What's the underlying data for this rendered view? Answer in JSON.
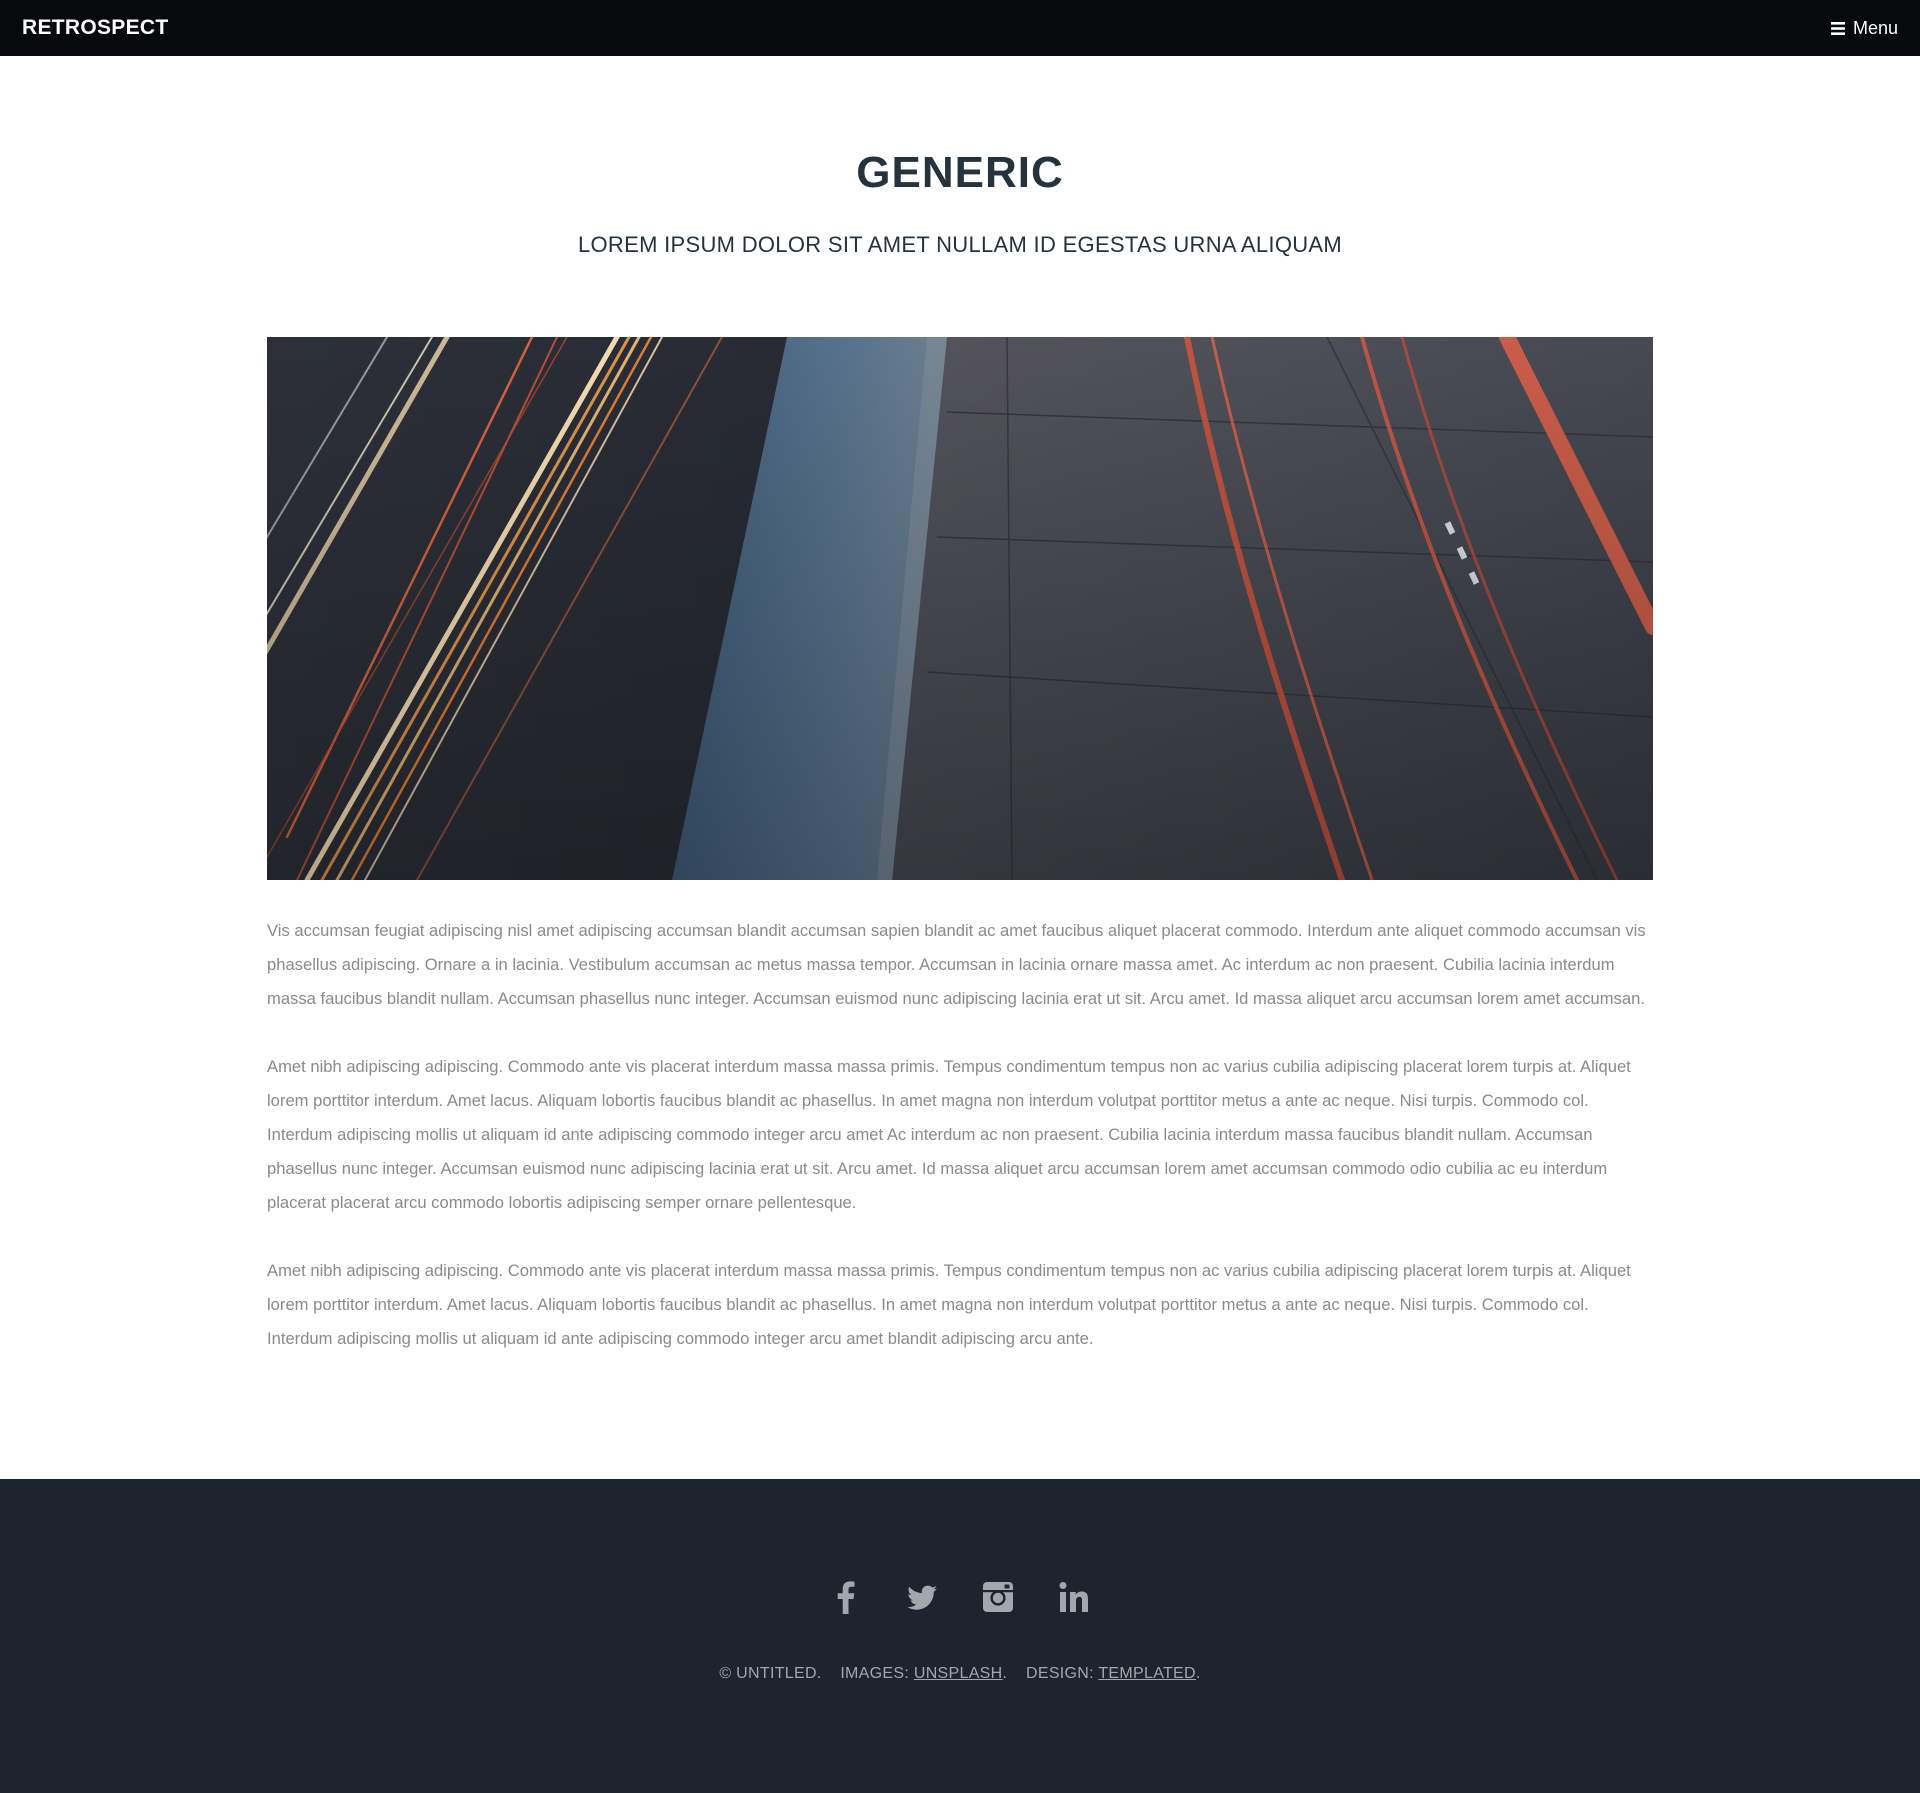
{
  "header": {
    "logo": "RETROSPECT",
    "menu_label": "Menu",
    "menu_icon": "hamburger-icon"
  },
  "main": {
    "title": "GENERIC",
    "subtitle": "LOREM IPSUM DOLOR SIT AMET NULLAM ID EGESTAS URNA ALIQUAM",
    "paragraphs": [
      "Vis accumsan feugiat adipiscing nisl amet adipiscing accumsan blandit accumsan sapien blandit ac amet faucibus aliquet placerat commodo. Interdum ante aliquet commodo accumsan vis phasellus adipiscing. Ornare a in lacinia. Vestibulum accumsan ac metus massa tempor. Accumsan in lacinia ornare massa amet. Ac interdum ac non praesent. Cubilia lacinia interdum massa faucibus blandit nullam. Accumsan phasellus nunc integer. Accumsan euismod nunc adipiscing lacinia erat ut sit. Arcu amet. Id massa aliquet arcu accumsan lorem amet accumsan.",
      "Amet nibh adipiscing adipiscing. Commodo ante vis placerat interdum massa massa primis. Tempus condimentum tempus non ac varius cubilia adipiscing placerat lorem turpis at. Aliquet lorem porttitor interdum. Amet lacus. Aliquam lobortis faucibus blandit ac phasellus. In amet magna non interdum volutpat porttitor metus a ante ac neque. Nisi turpis. Commodo col. Interdum adipiscing mollis ut aliquam id ante adipiscing commodo integer arcu amet Ac interdum ac non praesent. Cubilia lacinia interdum massa faucibus blandit nullam. Accumsan phasellus nunc integer. Accumsan euismod nunc adipiscing lacinia erat ut sit. Arcu amet. Id massa aliquet arcu accumsan lorem amet accumsan commodo odio cubilia ac eu interdum placerat placerat arcu commodo lobortis adipiscing semper ornare pellentesque.",
      "Amet nibh adipiscing adipiscing. Commodo ante vis placerat interdum massa massa primis. Tempus condimentum tempus non ac varius cubilia adipiscing placerat lorem turpis at. Aliquet lorem porttitor interdum. Amet lacus. Aliquam lobortis faucibus blandit ac phasellus. In amet magna non interdum volutpat porttitor metus a ante ac neque. Nisi turpis. Commodo col. Interdum adipiscing mollis ut aliquam id ante adipiscing commodo integer arcu amet blandit adipiscing arcu ante."
    ]
  },
  "footer": {
    "social": [
      {
        "name": "facebook-icon"
      },
      {
        "name": "twitter-icon"
      },
      {
        "name": "instagram-icon"
      },
      {
        "name": "linkedin-icon"
      }
    ],
    "copyright": "© UNTITLED.",
    "images_label": "IMAGES:",
    "images_link": "UNSPLASH",
    "design_label": "DESIGN:",
    "design_link": "TEMPLATED",
    "period": "."
  },
  "colors": {
    "header_bg": "#07090d",
    "title": "#25343c",
    "body_text": "#8a8a8a",
    "footer_bg": "#1e242d",
    "footer_text": "#a3a7ad"
  }
}
